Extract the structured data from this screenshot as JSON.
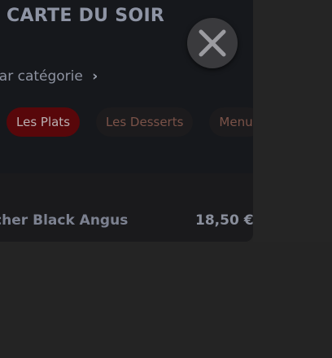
{
  "menu": {
    "title": "CARTE DU SOIR",
    "category_link": "par catégorie",
    "categories": [
      {
        "label": "Les Plats",
        "active": true
      },
      {
        "label": "Les Desserts",
        "active": false
      },
      {
        "label": "Menu",
        "active": false
      }
    ],
    "items": [
      {
        "name": "ucher Black Angus",
        "price": "18,50 €"
      }
    ]
  },
  "icons": {
    "close": "close-icon",
    "chevron": "chevron-right-icon"
  },
  "colors": {
    "accent": "#58070a",
    "sheet_bg": "#16181c",
    "backdrop": "#242424"
  }
}
